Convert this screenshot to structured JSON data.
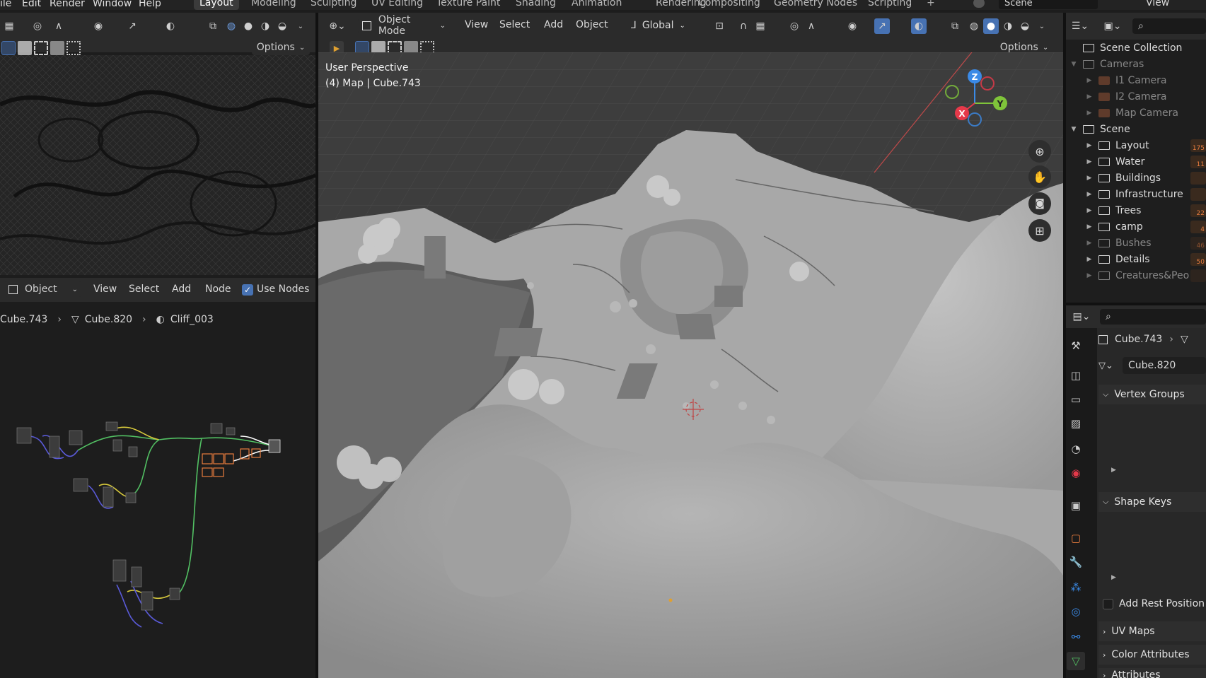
{
  "topbar": {
    "menus": [
      "ile",
      "Edit",
      "Render",
      "Window",
      "Help"
    ],
    "workspaces": [
      "Layout",
      "Modeling",
      "Sculpting",
      "UV Editing",
      "Texture Paint",
      "Shading",
      "Animation",
      "Rendering",
      "Compositing",
      "Geometry Nodes",
      "Scripting"
    ],
    "add_tab": "+",
    "scene_name": "Scene",
    "view_layer": "View"
  },
  "uv_editor": {
    "options_label": "Options"
  },
  "node_editor": {
    "mode_label": "Object",
    "menus": [
      "View",
      "Select",
      "Add",
      "Node"
    ],
    "use_nodes_label": "Use Nodes",
    "breadcrumb": [
      "Cube.743",
      "Cube.820",
      "Cliff_003"
    ]
  },
  "viewport": {
    "mode_label": "Object Mode",
    "menus": [
      "View",
      "Select",
      "Add",
      "Object"
    ],
    "transform_orientation": "Global",
    "options_label": "Options",
    "perspective_label": "User Perspective",
    "object_label": "(4) Map | Cube.743",
    "gizmo": {
      "x": "X",
      "y": "Y",
      "z": "Z"
    }
  },
  "outliner": {
    "root": "Scene Collection",
    "rows": [
      {
        "label": "Cameras",
        "type": "collection",
        "level": 1,
        "expanded": true,
        "dim": true
      },
      {
        "label": "I1 Camera",
        "type": "camera",
        "level": 2,
        "dim": true
      },
      {
        "label": "I2 Camera",
        "type": "camera",
        "level": 2,
        "dim": true
      },
      {
        "label": "Map Camera",
        "type": "camera",
        "level": 2,
        "dim": true
      },
      {
        "label": "Scene",
        "type": "collection",
        "level": 1,
        "expanded": true,
        "dim": false
      },
      {
        "label": "Layout",
        "type": "collection",
        "level": 2,
        "badge": "175",
        "dim": false
      },
      {
        "label": "Water",
        "type": "collection",
        "level": 2,
        "badge": "11",
        "dim": false
      },
      {
        "label": "Buildings",
        "type": "collection",
        "level": 2,
        "badge": "",
        "dim": false
      },
      {
        "label": "Infrastructure",
        "type": "collection",
        "level": 2,
        "badge": "",
        "dim": false
      },
      {
        "label": "Trees",
        "type": "collection",
        "level": 2,
        "badge": "22",
        "dim": false
      },
      {
        "label": "camp",
        "type": "collection",
        "level": 2,
        "badge": "4",
        "dim": false
      },
      {
        "label": "Bushes",
        "type": "collection",
        "level": 2,
        "badge": "46",
        "dim": true
      },
      {
        "label": "Details",
        "type": "collection",
        "level": 2,
        "badge": "50",
        "dim": false
      },
      {
        "label": "Creatures&Peo",
        "type": "collection",
        "level": 2,
        "badge": "",
        "dim": true
      }
    ]
  },
  "properties": {
    "object_name": "Cube.743",
    "mesh_name": "Cube.820",
    "sections": {
      "vertex_groups": "Vertex Groups",
      "shape_keys": "Shape Keys",
      "add_rest_position": "Add Rest Position",
      "uv_maps": "UV Maps",
      "color_attributes": "Color Attributes",
      "attributes": "Attributes"
    }
  },
  "colors": {
    "accent": "#4772b3",
    "active_green": "#52c063",
    "axis_x": "#e6394a",
    "axis_y": "#7fc43a",
    "axis_z": "#3b8ae6",
    "node_orange": "#e87d3e"
  }
}
